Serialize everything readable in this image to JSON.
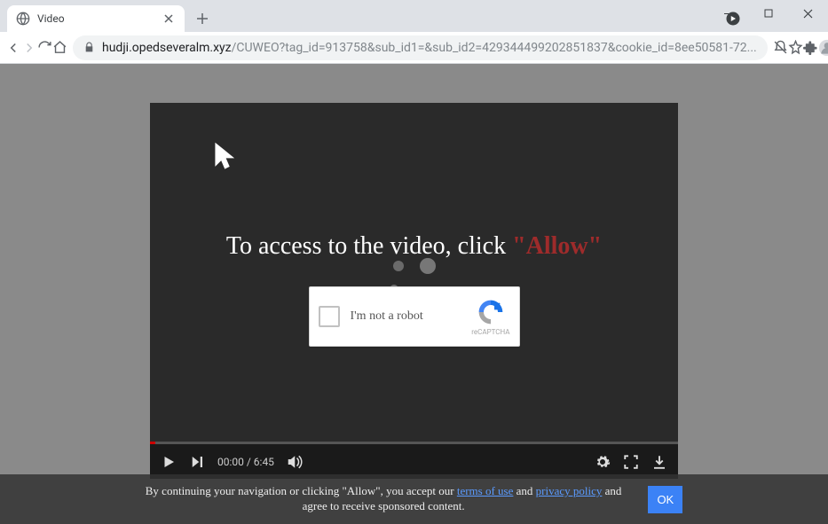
{
  "tab": {
    "title": "Video"
  },
  "address": {
    "domain": "hudji.opedseveralm.xyz",
    "path": "/CUWEO?tag_id=913758&sub_id1=&sub_id2=42934449920285183​7&cookie_id=8ee50581-72..."
  },
  "overlay": {
    "prefix": "To access to the video, click ",
    "allow": "\"Allow\""
  },
  "captcha": {
    "label": "I'm not a robot",
    "brand": "reCAPTCHA"
  },
  "player": {
    "time": "00:00 / 6:45"
  },
  "consent": {
    "line1_a": "By continuing your navigation or clicking \"Allow\", you accept our ",
    "terms": "terms of use",
    "mid": " and ",
    "privacy": "privacy policy",
    "line1_b": " and",
    "line2": "agree to receive sponsored content.",
    "ok": "OK"
  }
}
